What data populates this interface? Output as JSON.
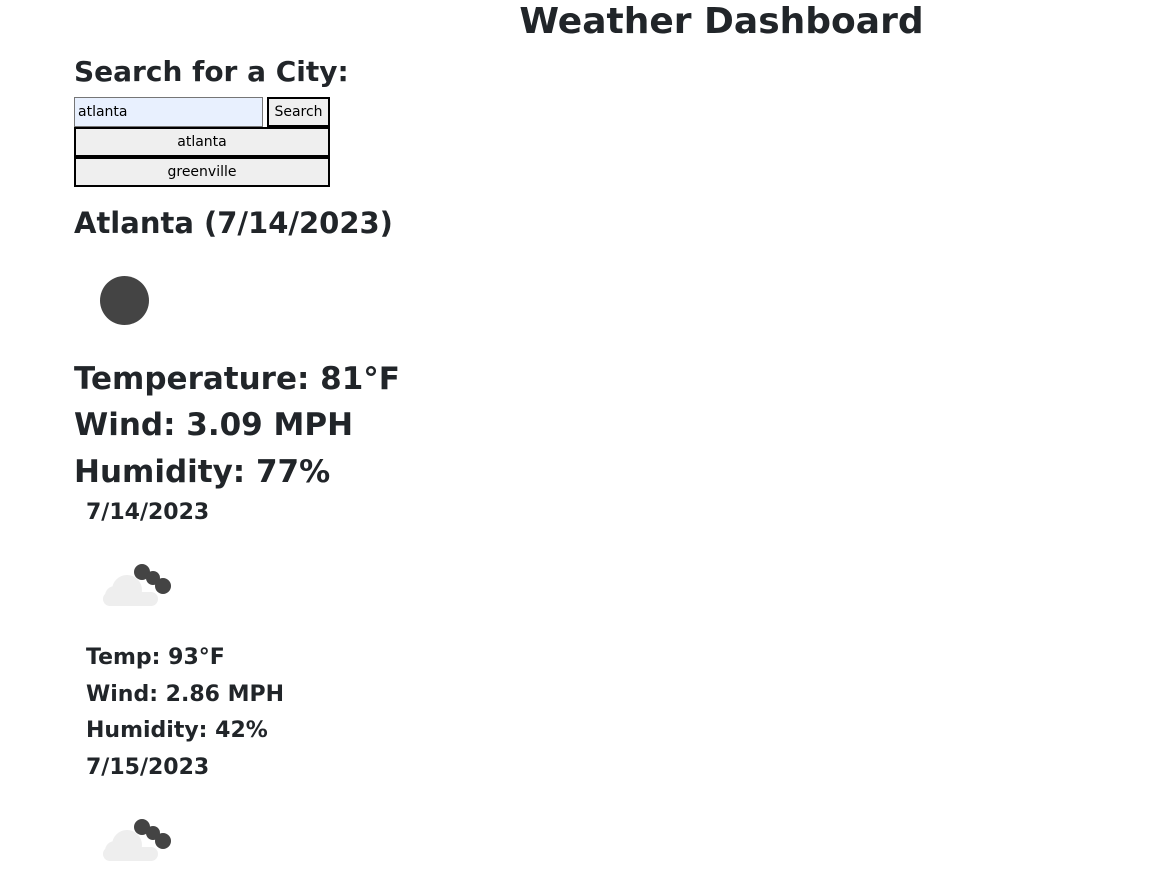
{
  "header": {
    "title": "Weather Dashboard"
  },
  "search": {
    "heading": "Search for a City:",
    "input_value": "atlanta",
    "button_label": "Search",
    "history": [
      "atlanta",
      "greenville"
    ]
  },
  "current": {
    "heading": "Atlanta (7/14/2023)",
    "icon": "clear-night-icon",
    "temperature": "Temperature: 81°F",
    "wind": "Wind: 3.09 MPH",
    "humidity": "Humidity: 77%"
  },
  "forecast": [
    {
      "date": "7/14/2023",
      "icon": "partly-cloudy-night-icon",
      "temp": "Temp: 93°F",
      "wind": "Wind: 2.86 MPH",
      "humidity": "Humidity: 42%"
    },
    {
      "date": "7/15/2023",
      "icon": "partly-cloudy-night-icon"
    }
  ],
  "colors": {
    "text": "#212529",
    "icon_dark": "#444444",
    "cloud": "#eeeeee"
  }
}
